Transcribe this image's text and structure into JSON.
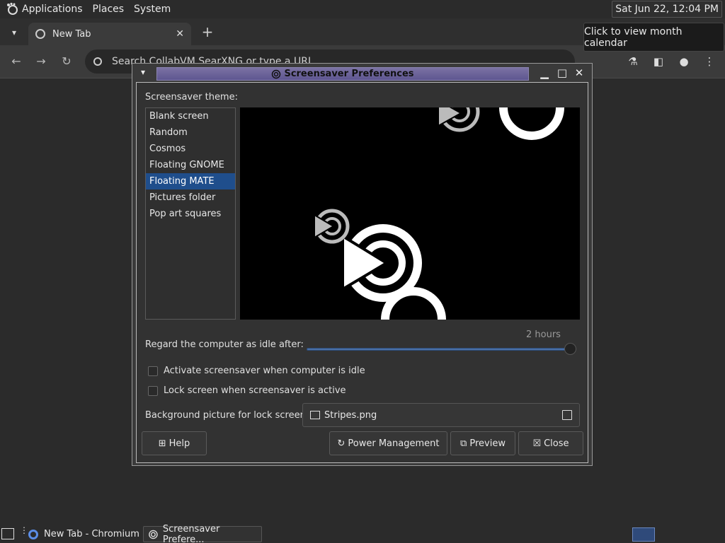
{
  "top_panel": {
    "menus": [
      "Applications",
      "Places",
      "System"
    ],
    "clock": "Sat Jun 22, 12:04 PM",
    "tooltip": "Click to view month calendar"
  },
  "browser": {
    "tab_title": "New Tab",
    "omnibox_placeholder": "Search CollabVM SearXNG or type a URL"
  },
  "dialog": {
    "title": "Screensaver Preferences",
    "theme_label": "Screensaver theme:",
    "themes": [
      "Blank screen",
      "Random",
      "Cosmos",
      "Floating GNOME",
      "Floating MATE",
      "Pictures folder",
      "Pop art squares"
    ],
    "selected_theme": "Floating MATE",
    "idle_label": "Regard the computer as idle after:",
    "idle_value": "2 hours",
    "idle_slider_fraction": 1.0,
    "activate_label": "Activate screensaver when computer is idle",
    "activate_checked": false,
    "lock_label": "Lock screen when screensaver is active",
    "lock_checked": false,
    "bg_label": "Background picture for lock screen:",
    "bg_file": "Stripes.png",
    "buttons": {
      "help": "Help",
      "power": "Power Management",
      "preview": "Preview",
      "close": "Close"
    }
  },
  "taskbar": {
    "tasks": [
      "New Tab - Chromium",
      "Screensaver Prefere..."
    ]
  }
}
